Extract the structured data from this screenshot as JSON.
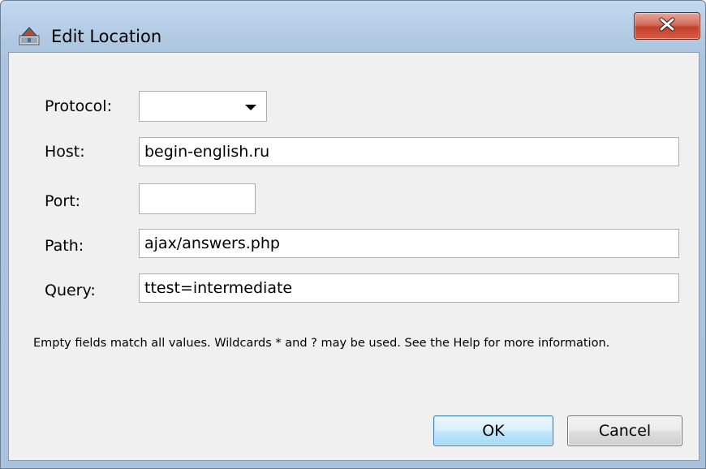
{
  "window": {
    "title": "Edit Location",
    "close_symbol": "X",
    "icon": "location-editor-icon"
  },
  "form": {
    "protocol": {
      "label": "Protocol:",
      "value": ""
    },
    "host": {
      "label": "Host:",
      "value": "begin-english.ru"
    },
    "port": {
      "label": "Port:",
      "value": ""
    },
    "path": {
      "label": "Path:",
      "value": "ajax/answers.php"
    },
    "query": {
      "label": "Query:",
      "value": "ttest=intermediate"
    }
  },
  "hint": "Empty fields match all values. Wildcards * and ? may be used. See the Help for more information.",
  "buttons": {
    "ok": "OK",
    "cancel": "Cancel"
  },
  "colors": {
    "close_button": "#c4412c",
    "default_button_border": "#3c7fb1",
    "title_bar": "#b3cbe4"
  }
}
